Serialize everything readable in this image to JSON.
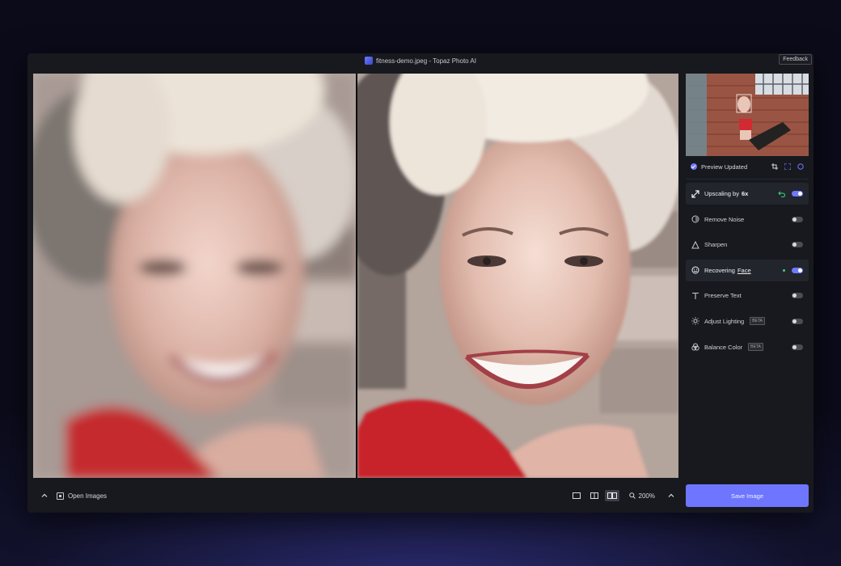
{
  "titlebar": {
    "title": "fitness-demo.jpeg - Topaz Photo AI",
    "feedback_label": "Feedback"
  },
  "viewer": {
    "left_pane": "original",
    "right_pane": "enhanced"
  },
  "bottombar": {
    "open_images_label": "Open Images",
    "zoom_label": "200%",
    "active_view": "side-by-side"
  },
  "sidebar": {
    "preview_status": "Preview Updated",
    "features": [
      {
        "label": "Upscaling by",
        "strong": "6x",
        "icon": "upscale-icon",
        "enabled": true,
        "highlight": true,
        "extra": "undo"
      },
      {
        "label": "Remove Noise",
        "icon": "noise-icon",
        "enabled": false
      },
      {
        "label": "Sharpen",
        "icon": "triangle-icon",
        "enabled": false
      },
      {
        "label": "Recovering",
        "strong_u": "Face",
        "icon": "face-icon",
        "enabled": true,
        "highlight": true,
        "extra": "dot"
      },
      {
        "label": "Preserve Text",
        "icon": "text-icon",
        "enabled": false
      },
      {
        "label": "Adjust Lighting",
        "beta": "BETA",
        "icon": "sun-icon",
        "enabled": false
      },
      {
        "label": "Balance Color",
        "beta": "BETA",
        "icon": "color-icon",
        "enabled": false
      }
    ]
  },
  "save_button": {
    "label": "Save Image"
  },
  "colors": {
    "accent": "#6e76ff",
    "toggle_on": "#6f79ff",
    "panel_bg": "#17191e",
    "highlight_row": "#22252b"
  }
}
